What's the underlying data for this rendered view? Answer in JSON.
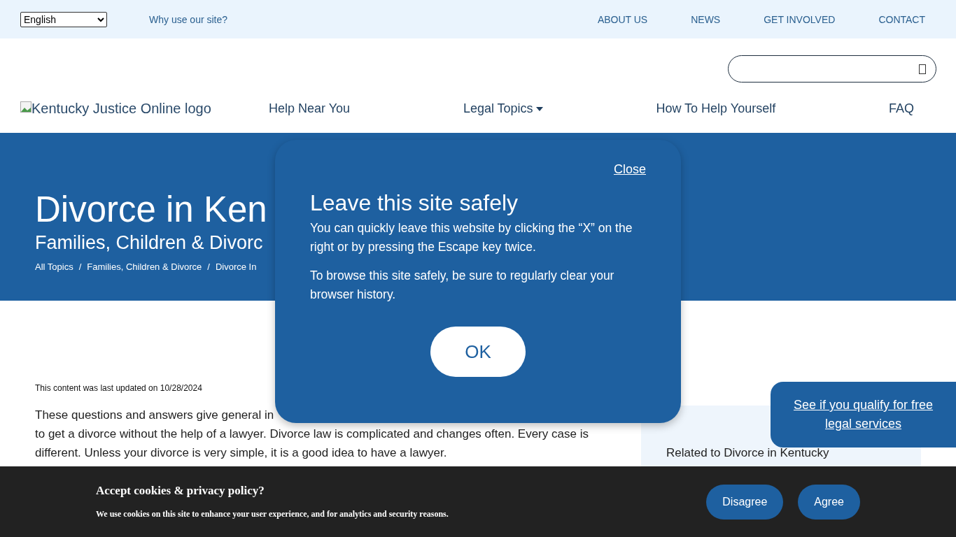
{
  "top_bar": {
    "language": {
      "value": "English"
    },
    "why_link": "Why use our site?",
    "links": [
      "ABOUT US",
      "NEWS",
      "GET INVOLVED",
      "CONTACT"
    ]
  },
  "header": {
    "logo_alt": "Kentucky Justice Online logo",
    "nav": [
      {
        "label": "Help Near You",
        "dropdown": false
      },
      {
        "label": "Legal Topics",
        "dropdown": true
      },
      {
        "label": "How To Help Yourself",
        "dropdown": false
      },
      {
        "label": "FAQ",
        "dropdown": false
      }
    ]
  },
  "hero": {
    "title": "Divorce in Ken",
    "subtitle": "Families, Children & Divorc",
    "breadcrumbs": [
      "All Topics",
      "Families, Children & Divorce",
      "Divorce In"
    ],
    "separator": "/"
  },
  "content": {
    "updated": "This content was last updated on 10/28/2024",
    "intro_lines": [
      "These questions and answers give general in",
      "to get a divorce without the help of a lawyer. Divorce law is complicated and changes often. Every case is",
      "different. Unless your divorce is very simple, it is a good idea to have a lawyer."
    ]
  },
  "sidebar": {
    "heading": "Related to Divorce in Kentucky"
  },
  "qualify_button": "See if you qualify for free legal services",
  "modal": {
    "close": "Close",
    "title": "Leave this site safely",
    "paragraphs": [
      "You can quickly leave this website by clicking the “X” on the right or by pressing the Escape key twice.",
      "To browse this site safely, be sure to regularly clear your browser history."
    ],
    "ok": "OK"
  },
  "cookie_bar": {
    "title": "Accept cookies & privacy policy?",
    "text": "We use cookies on this site to enhance your user experience, and for analytics and security reasons.",
    "buttons": [
      "Disagree",
      "Agree"
    ]
  }
}
